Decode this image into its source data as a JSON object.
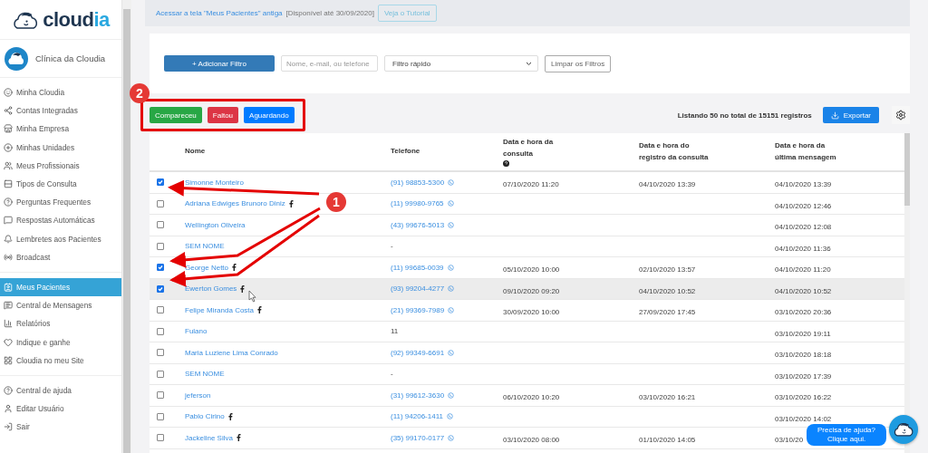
{
  "logo": {
    "text_main": "cloud",
    "text_accent": "ia"
  },
  "clinic": {
    "name": "Clínica da Cloudia"
  },
  "sidebar": {
    "groups": [
      [
        {
          "label": "Minha Cloudia",
          "selected": false
        },
        {
          "label": "Contas Integradas",
          "selected": false
        },
        {
          "label": "Minha Empresa",
          "selected": false
        },
        {
          "label": "Minhas Unidades",
          "selected": false
        },
        {
          "label": "Meus Profissionais",
          "selected": false
        },
        {
          "label": "Tipos de Consulta",
          "selected": false
        },
        {
          "label": "Perguntas Frequentes",
          "selected": false
        },
        {
          "label": "Respostas Automáticas",
          "selected": false
        },
        {
          "label": "Lembretes aos Pacientes",
          "selected": false
        },
        {
          "label": "Broadcast",
          "selected": false
        }
      ],
      [
        {
          "label": "Meus Pacientes",
          "selected": true
        },
        {
          "label": "Central de Mensagens",
          "selected": false
        },
        {
          "label": "Relatórios",
          "selected": false
        },
        {
          "label": "Indique e ganhe",
          "selected": false
        },
        {
          "label": "Cloudia no meu Site",
          "selected": false
        }
      ],
      [
        {
          "label": "Central de ajuda",
          "selected": false
        },
        {
          "label": "Editar Usuário",
          "selected": false
        },
        {
          "label": "Sair",
          "selected": false
        }
      ]
    ]
  },
  "banner": {
    "link": "Acessar a tela \"Meus Pacientes\" antiga",
    "note": "[Disponível até 30/09/2020]",
    "button": "Veja o Tutorial"
  },
  "filters": {
    "add_button": "+ Adicionar Filtro",
    "search_placeholder": "Nome, e-mail, ou telefone",
    "quick_filter": "Filtro rápido",
    "clear_button": "Limpar os Filtros"
  },
  "actions": [
    {
      "label": "Compareceu",
      "kind": "success"
    },
    {
      "label": "Faltou",
      "kind": "danger"
    },
    {
      "label": "Aguardando",
      "kind": "primary"
    }
  ],
  "summary": "Listando 50 no total de 15151 registros",
  "export_button": "Exportar",
  "table": {
    "columns": [
      "Nome",
      "Telefone",
      "Data e hora da consulta",
      "Data e hora do registro da consulta",
      "Data e hora da última mensagem"
    ],
    "rows": [
      {
        "checked": true,
        "highlighted": false,
        "name": "Simonne Monteiro",
        "facebook": false,
        "phone": "(91) 98853-5300",
        "whatsapp": true,
        "consultation": "07/10/2020 11:20",
        "registered": "04/10/2020 13:39",
        "last_message": "04/10/2020 13:39"
      },
      {
        "checked": false,
        "highlighted": false,
        "name": "Adriana Edwiges Brunoro Diniz",
        "facebook": true,
        "phone": "(11) 99980-9765",
        "whatsapp": true,
        "last_message": "04/10/2020 12:46"
      },
      {
        "checked": false,
        "highlighted": false,
        "name": "Wellington Oliveira",
        "facebook": false,
        "phone": "(43) 99676-5013",
        "whatsapp": true,
        "last_message": "04/10/2020 12:08"
      },
      {
        "checked": false,
        "highlighted": false,
        "name": "SEM NOME",
        "facebook": false,
        "phone": "-",
        "whatsapp": false,
        "last_message": "04/10/2020 11:36"
      },
      {
        "checked": true,
        "highlighted": false,
        "name": "George Netto",
        "facebook": true,
        "phone": "(11) 99685-0039",
        "whatsapp": true,
        "consultation": "05/10/2020 10:00",
        "registered": "02/10/2020 13:57",
        "last_message": "04/10/2020 11:20"
      },
      {
        "checked": true,
        "highlighted": true,
        "name": "Ewerton Gomes",
        "facebook": true,
        "phone": "(93) 99204-4277",
        "whatsapp": true,
        "consultation": "09/10/2020 09:20",
        "registered": "04/10/2020 10:52",
        "last_message": "04/10/2020 10:52"
      },
      {
        "checked": false,
        "highlighted": false,
        "name": "Felipe Miranda Costa",
        "facebook": true,
        "phone": "(21) 99369-7989",
        "whatsapp": true,
        "consultation": "30/09/2020 10:00",
        "registered": "27/09/2020 17:45",
        "last_message": "03/10/2020 20:36"
      },
      {
        "checked": false,
        "highlighted": false,
        "name": "Fulano",
        "facebook": false,
        "phone": "11",
        "whatsapp": false,
        "last_message": "03/10/2020 19:11"
      },
      {
        "checked": false,
        "highlighted": false,
        "name": "Maria Luziene Lima Conrado",
        "facebook": false,
        "phone": "(92) 99349-6691",
        "whatsapp": true,
        "last_message": "03/10/2020 18:18"
      },
      {
        "checked": false,
        "highlighted": false,
        "name": "SEM NOME",
        "facebook": false,
        "phone": "-",
        "whatsapp": false,
        "last_message": "03/10/2020 17:39"
      },
      {
        "checked": false,
        "highlighted": false,
        "name": "jeferson",
        "facebook": false,
        "phone": "(31) 99612-3630",
        "whatsapp": true,
        "consultation": "06/10/2020 10:20",
        "registered": "03/10/2020 16:21",
        "last_message": "03/10/2020 16:22"
      },
      {
        "checked": false,
        "highlighted": false,
        "name": "Pablo Cirino",
        "facebook": true,
        "phone": "(11) 94206-1411",
        "whatsapp": true,
        "last_message": "03/10/2020 14:02"
      },
      {
        "checked": false,
        "highlighted": false,
        "name": "Jackeline Silva",
        "facebook": true,
        "phone": "(35) 99170-0177",
        "whatsapp": true,
        "consultation": "03/10/2020 08:00",
        "registered": "01/10/2020 14:05",
        "last_message": "03/10/20"
      }
    ]
  },
  "annotations": [
    {
      "number": "1"
    },
    {
      "number": "2"
    }
  ],
  "help_bubble": "Precisa de ajuda? Clique aqui."
}
